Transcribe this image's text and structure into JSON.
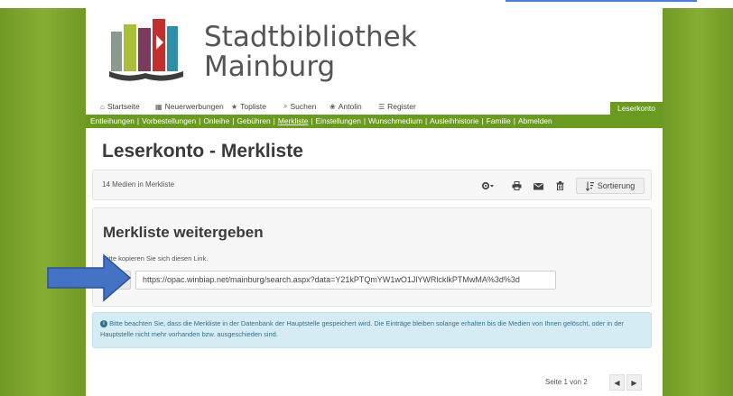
{
  "site": {
    "name_line1": "Stadtbibliothek",
    "name_line2": "Mainburg"
  },
  "topnav": {
    "items": [
      {
        "icon": "home-icon",
        "glyph": "⌂",
        "label": "Startseite"
      },
      {
        "icon": "calendar-icon",
        "glyph": "▦",
        "label": "Neuerwerbungen"
      },
      {
        "icon": "star-icon",
        "glyph": "★",
        "label": "Topliste"
      },
      {
        "icon": "search-icon",
        "glyph": "⌕",
        "label": "Suchen"
      },
      {
        "icon": "antolin-icon",
        "glyph": "❀",
        "label": "Antolin"
      },
      {
        "icon": "list-icon",
        "glyph": "☰",
        "label": "Register"
      }
    ],
    "account_label": "Leserkonto"
  },
  "subnav": {
    "items": [
      "Entleihungen",
      "Vorbestellungen",
      "Onleihe",
      "Gebühren",
      "Merkliste",
      "Einstellungen",
      "Wunschmedium",
      "Ausleihhistorie",
      "Familie",
      "Abmelden"
    ],
    "active": "Merkliste"
  },
  "page": {
    "title": "Leserkonto - Merkliste"
  },
  "toolbar": {
    "count_text": "14 Medien in Merkliste",
    "settings_icon": "gear-icon",
    "print_icon": "print-icon",
    "mail_icon": "envelope-icon",
    "delete_icon": "trash-icon",
    "sort_label": "Sortierung"
  },
  "share": {
    "title": "Merkliste weitergeben",
    "hint": "Bitte kopieren Sie sich diesen Link.",
    "copy_icon": "copy-icon",
    "link": "https://opac.winbiap.net/mainburg/search.aspx?data=Y21kPTQmYW1wO1JlYWRlcklkPTMwMA%3d%3d"
  },
  "info": {
    "icon": "info-icon",
    "text": "Bitte beachten Sie, dass die Merkliste in der Datenbank der Hauptstelle gespeichert wird. Die Einträge bleiben solange erhalten bis die Medien von Ihnen gelöscht, oder in der Hauptstelle nicht mehr vorhanden bzw. ausgeschieden sind."
  },
  "pager": {
    "label": "Seite 1 von 2"
  },
  "colors": {
    "brand_green": "#6a9a20",
    "arrow_blue": "#4472c4",
    "info_bg": "#d6ecf4"
  }
}
